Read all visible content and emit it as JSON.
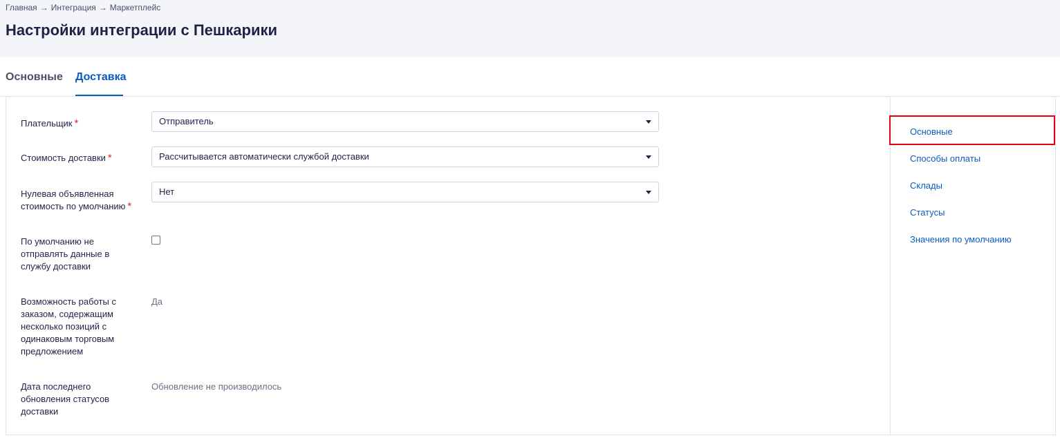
{
  "breadcrumb": [
    "Главная",
    "Интеграция",
    "Маркетплейс"
  ],
  "breadcrumb_sep": "→",
  "page_title": "Настройки интеграции с Пешкарики",
  "tabs": [
    {
      "label": "Основные",
      "active": false
    },
    {
      "label": "Доставка",
      "active": true
    }
  ],
  "form": {
    "payer": {
      "label": "Плательщик",
      "required": "*",
      "value": "Отправитель"
    },
    "delivery_cost": {
      "label": "Стоимость доставки",
      "required": "*",
      "value": "Рассчитывается автоматически службой доставки"
    },
    "zero_declared": {
      "label_line1": "Нулевая объявленная",
      "label_line2": "стоимость по умолчанию",
      "required": "*",
      "value": "Нет"
    },
    "no_send": {
      "label": "По умолчанию не отправлять данные в службу доставки",
      "checked": false
    },
    "multi_position": {
      "label": "Возможность работы с заказом, содержащим несколько позиций с одинаковым торговым предложением",
      "value": "Да"
    },
    "last_update": {
      "label": "Дата последнего обновления статусов доставки",
      "value": "Обновление не производилось"
    }
  },
  "sidenav": [
    "Основные",
    "Способы оплаты",
    "Склады",
    "Статусы",
    "Значения по умолчанию"
  ],
  "colors": {
    "accent": "#0a5bc1",
    "highlight": "#e3000f",
    "required": "#e0262a"
  }
}
